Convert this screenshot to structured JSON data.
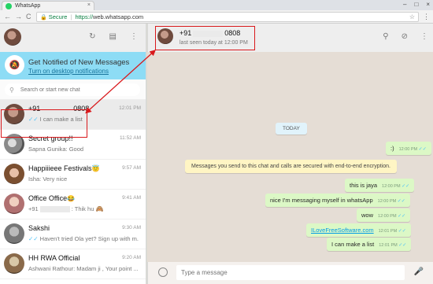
{
  "browser": {
    "tab_title": "WhatsApp",
    "tab_close": "×",
    "window_controls": [
      "–",
      "□",
      "×"
    ],
    "back": "←",
    "forward": "→",
    "reload": "C",
    "secure_label": "Secure",
    "url_scheme": "https://",
    "url_rest": "web.whatsapp.com",
    "star": "☆",
    "menu": "⋮"
  },
  "sidebar": {
    "icons": {
      "status": "↻",
      "chat": "▤",
      "menu": "⋮"
    },
    "notification": {
      "icon": "🔕",
      "title": "Get Notified of New Messages",
      "link": "Turn on desktop notifications"
    },
    "search": {
      "icon": "⚲",
      "placeholder": "Search or start new chat"
    },
    "chats": [
      {
        "name_prefix": "+91",
        "name_suffix": "0808",
        "time": "12:01 PM",
        "check": "✓✓",
        "preview": "I can make a list"
      },
      {
        "name": "Secret group!!",
        "time": "11:52 AM",
        "preview": "Sapna Gunika: Good"
      },
      {
        "name": "Happiiieee Festivals",
        "emoji": "😇",
        "time": "9:57 AM",
        "preview": "Isha: Very nice"
      },
      {
        "name": "Office Office",
        "emoji": "😂",
        "time": "9:41 AM",
        "preview_prefix": "+91",
        "preview_suffix": ": Thik hu",
        "preview_emoji": "🙈"
      },
      {
        "name": "Sakshi",
        "time": "9:30 AM",
        "check": "✓✓",
        "preview": "Haven't tried Ola yet? Sign up with m..."
      },
      {
        "name": "HH RWA Official",
        "time": "9:20 AM",
        "preview": "Ashwani Rathour: Madam ji , Your point ..."
      }
    ]
  },
  "conversation": {
    "contact_prefix": "+91",
    "contact_suffix": "0808",
    "status": "last seen today at 12:00 PM",
    "icons": {
      "search": "⚲",
      "attach": "⊘",
      "menu": "⋮"
    },
    "day_label": "TODAY",
    "system_notice": "Messages you send to this chat and calls are secured with end-to-end encryption.",
    "messages": [
      {
        "text": ":)",
        "time": "12:00 PM",
        "check": "✓✓"
      },
      {
        "text": "this is jaya",
        "time": "12:00 PM",
        "check": "✓✓"
      },
      {
        "text": "nice I'm messaging myself in whatsApp",
        "time": "12:00 PM",
        "check": "✓✓"
      },
      {
        "text": "wow",
        "time": "12:00 PM",
        "check": "✓✓"
      },
      {
        "text": "ILoveFreeSoftware.com",
        "time": "12:01 PM",
        "check": "✓✓"
      },
      {
        "text": "I can make a list",
        "time": "12:01 PM",
        "check": "✓✓"
      }
    ],
    "composer": {
      "placeholder": "Type a message",
      "mic": "🎤"
    }
  }
}
